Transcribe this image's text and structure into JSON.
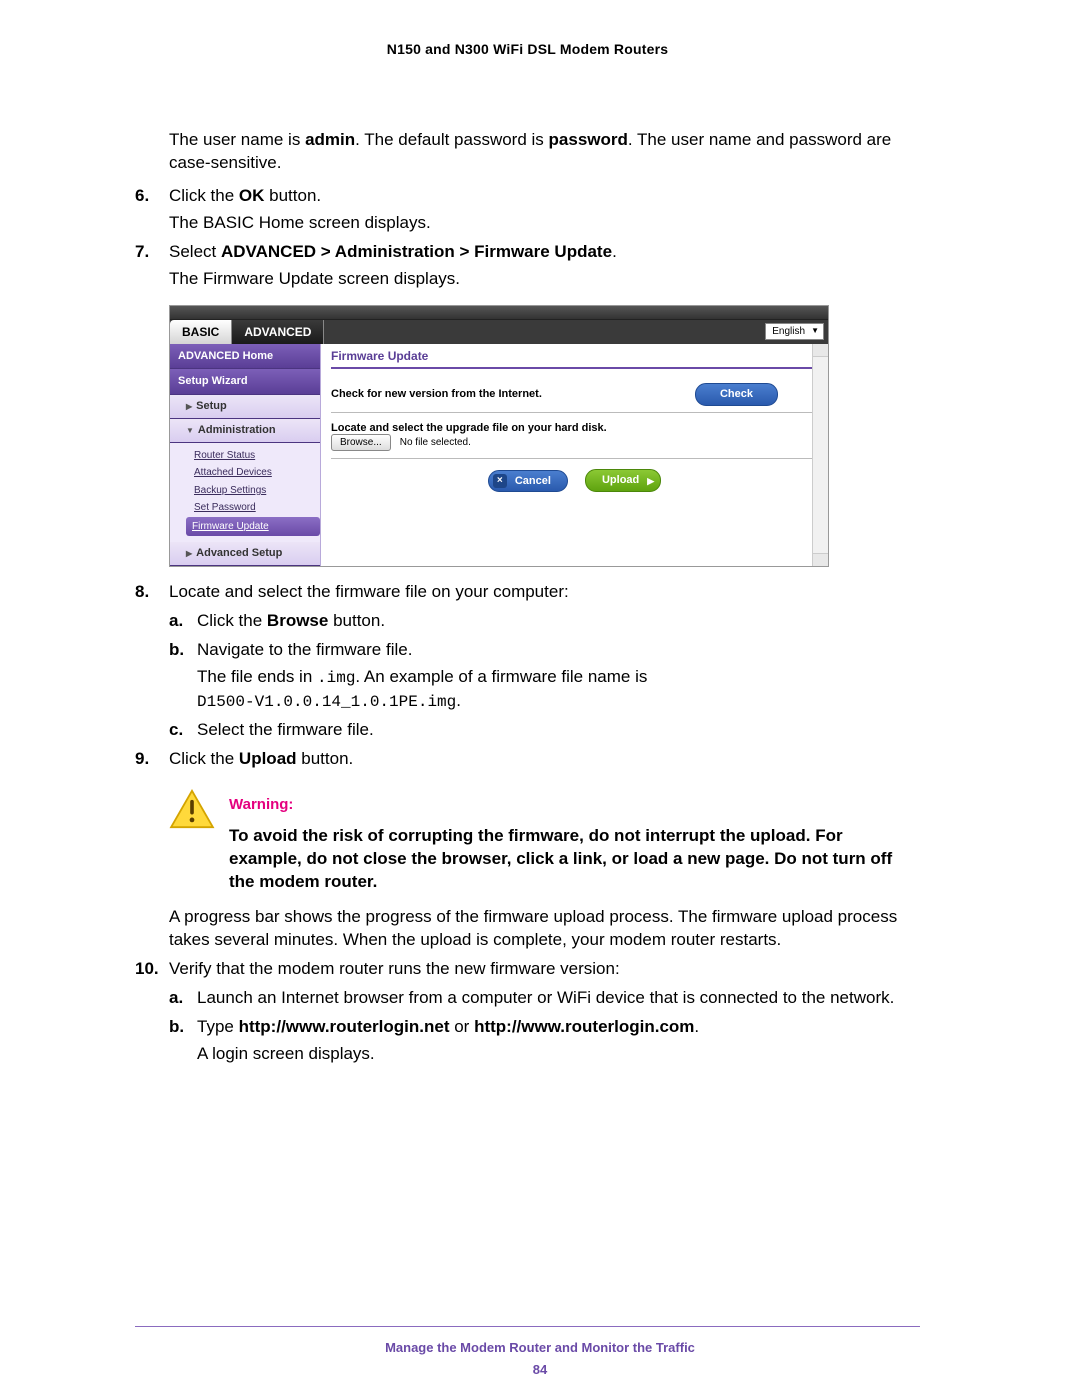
{
  "header": "N150 and N300 WiFi DSL Modem Routers",
  "intro": {
    "pre": "The user name is ",
    "bold1": "admin",
    "mid": ". The default password is ",
    "bold2": "password",
    "post": ". The user name and password are case-sensitive."
  },
  "steps": {
    "s6_num": "6.",
    "s6a": "Click the ",
    "s6b": "OK",
    "s6c": " button.",
    "s6_sub": "The BASIC Home screen displays.",
    "s7_num": "7.",
    "s7a": "Select ",
    "s7b": "ADVANCED > Administration > Firmware Update",
    "s7c": ".",
    "s7_sub": "The Firmware Update screen displays.",
    "s8_num": "8.",
    "s8": "Locate and select the firmware file on your computer:",
    "s8a_l": "a.",
    "s8a_1": "Click the ",
    "s8a_2": "Browse",
    "s8a_3": " button.",
    "s8b_l": "b.",
    "s8b": "Navigate to the firmware file.",
    "s8b_sub1": "The file ends in ",
    "s8b_code1": ".img",
    "s8b_sub2": ". An example of a firmware file name is ",
    "s8b_code2": "D1500-V1.0.0.14_1.0.1PE.img",
    "s8b_sub3": ".",
    "s8c_l": "c.",
    "s8c": "Select the firmware file.",
    "s9_num": "9.",
    "s9a": "Click the ",
    "s9b": "Upload",
    "s9c": " button.",
    "s9_para": "A progress bar shows the progress of the firmware upload process. The firmware upload process takes several minutes. When the upload is complete, your modem router restarts.",
    "s10_num": "10.",
    "s10": "Verify that the modem router runs the new firmware version:",
    "s10a_l": "a.",
    "s10a": "Launch an Internet browser from a computer or WiFi device that is connected to the network.",
    "s10b_l": "b.",
    "s10b_1": "Type ",
    "s10b_2": "http://www.routerlogin.net",
    "s10b_3": " or ",
    "s10b_4": "http://www.routerlogin.com",
    "s10b_5": ".",
    "s10b_sub": "A login screen displays."
  },
  "warning": {
    "title": "Warning:",
    "body": "To avoid the risk of corrupting the firmware, do not interrupt the upload. For example, do not close the browser, click a link, or load a new page. Do not turn off the modem router."
  },
  "ui": {
    "tab_basic": "BASIC",
    "tab_advanced": "ADVANCED",
    "language": "English",
    "side_home": "ADVANCED Home",
    "side_wizard": "Setup Wizard",
    "side_setup": "Setup",
    "side_admin": "Administration",
    "side_advsetup": "Advanced Setup",
    "admin_links": {
      "l1": "Router Status",
      "l2": "Attached Devices",
      "l3": "Backup Settings",
      "l4": "Set Password",
      "l5": "Firmware Update"
    },
    "panel_title": "Firmware Update",
    "check_label": "Check for new version from the Internet.",
    "check_btn": "Check",
    "locate_label": "Locate and select the upgrade file on your hard disk.",
    "browse_btn": "Browse...",
    "no_file": "No file selected.",
    "cancel_btn": "Cancel",
    "upload_btn": "Upload"
  },
  "footer": {
    "section": "Manage the Modem Router and Monitor the Traffic",
    "page": "84"
  }
}
